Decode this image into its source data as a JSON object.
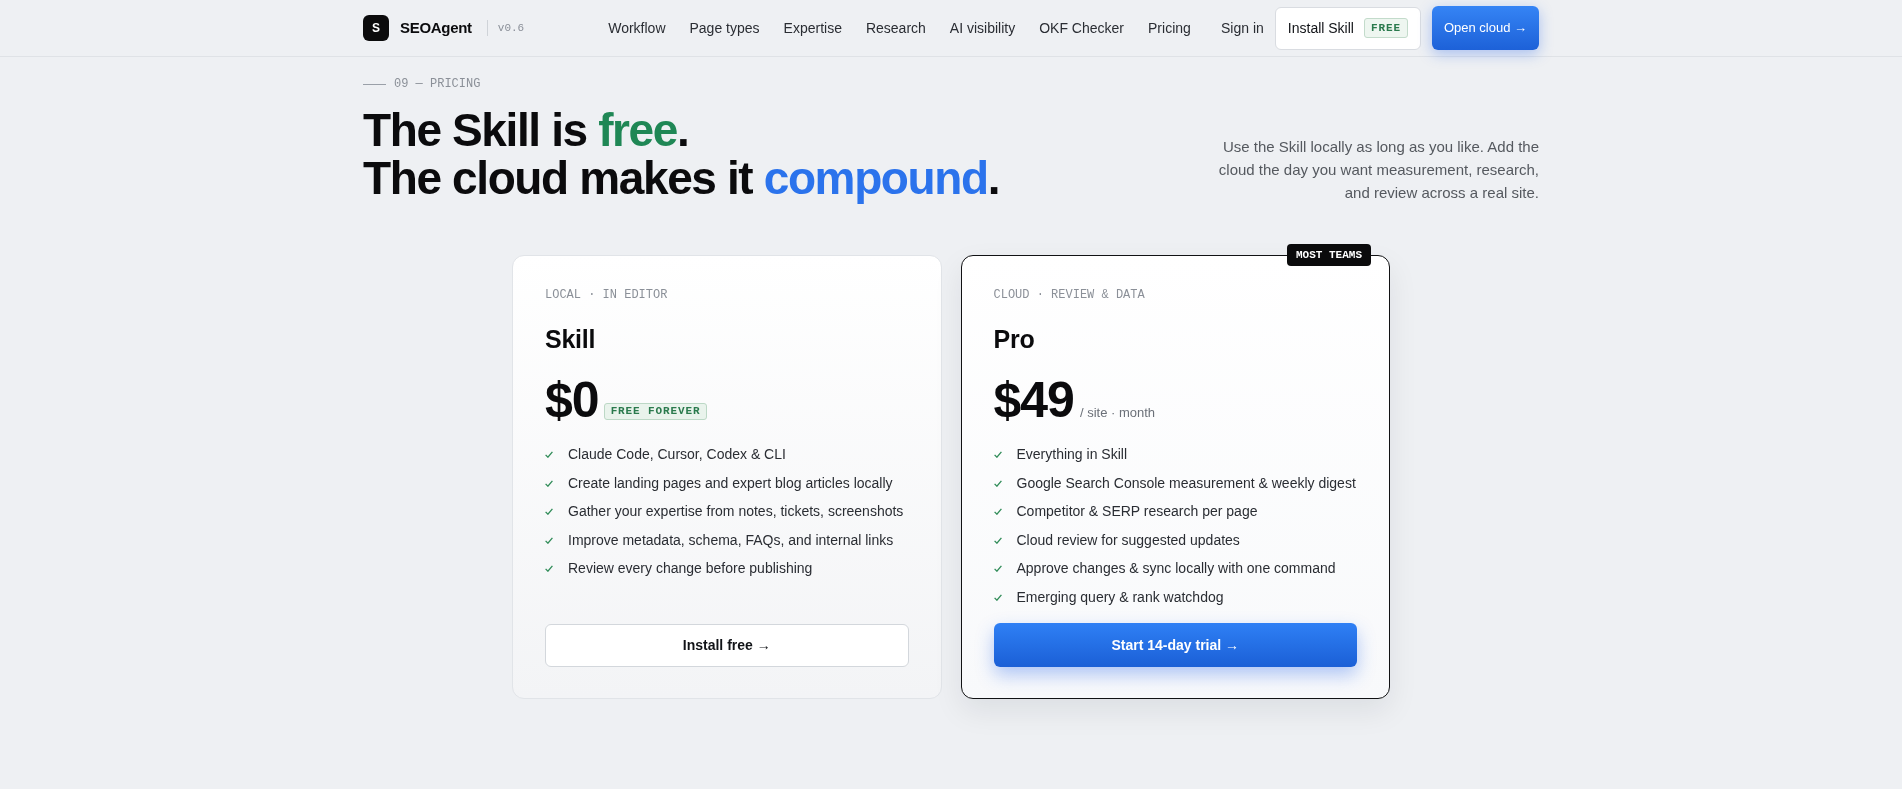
{
  "header": {
    "logo_mark": "S",
    "brand": "SEOAgent",
    "version": "v0.6",
    "nav": [
      "Workflow",
      "Page types",
      "Expertise",
      "Research",
      "AI visibility",
      "OKF Checker",
      "Pricing"
    ],
    "sign_in": "Sign in",
    "install_button": {
      "label": "Install Skill",
      "badge": "FREE"
    },
    "open_cloud_button": "Open cloud →"
  },
  "section": {
    "eyebrow": "09 — PRICING",
    "heading": {
      "lines": [
        {
          "parts": [
            {
              "text": "The Skill is ",
              "color": "#0b0b0d"
            },
            {
              "text": "free",
              "color": "#1f8755"
            },
            {
              "text": ".",
              "color": "#0b0b0d"
            }
          ]
        },
        {
          "parts": [
            {
              "text": "The cloud makes it ",
              "color": "#0b0b0d"
            },
            {
              "text": "compound",
              "color": "#2b73ec"
            },
            {
              "text": ".",
              "color": "#0b0b0d"
            }
          ]
        }
      ]
    },
    "description": "Use the Skill locally as long as you like. Add the cloud the day you want measurement, research, and review across a real site."
  },
  "plans": [
    {
      "featured": false,
      "eyebrow": "LOCAL · IN EDITOR",
      "name": "Skill",
      "price": "$0",
      "price_badge": "FREE FOREVER",
      "features": [
        "Claude Code, Cursor, Codex & CLI",
        "Create landing pages and expert blog articles locally",
        "Gather your expertise from notes, tickets, screenshots",
        "Improve metadata, schema, FAQs, and internal links",
        "Review every change before publishing"
      ],
      "cta": "Install free →"
    },
    {
      "featured": true,
      "ribbon": "MOST TEAMS",
      "eyebrow": "CLOUD · REVIEW & DATA",
      "name": "Pro",
      "price": "$49",
      "price_note": "/ site · month",
      "features": [
        "Everything in Skill",
        "Google Search Console measurement & weekly digest",
        "Competitor & SERP research per page",
        "Cloud review for suggested updates",
        "Approve changes & sync locally with one command",
        "Emerging query & rank watchdog"
      ],
      "cta": "Start 14-day trial →"
    }
  ]
}
